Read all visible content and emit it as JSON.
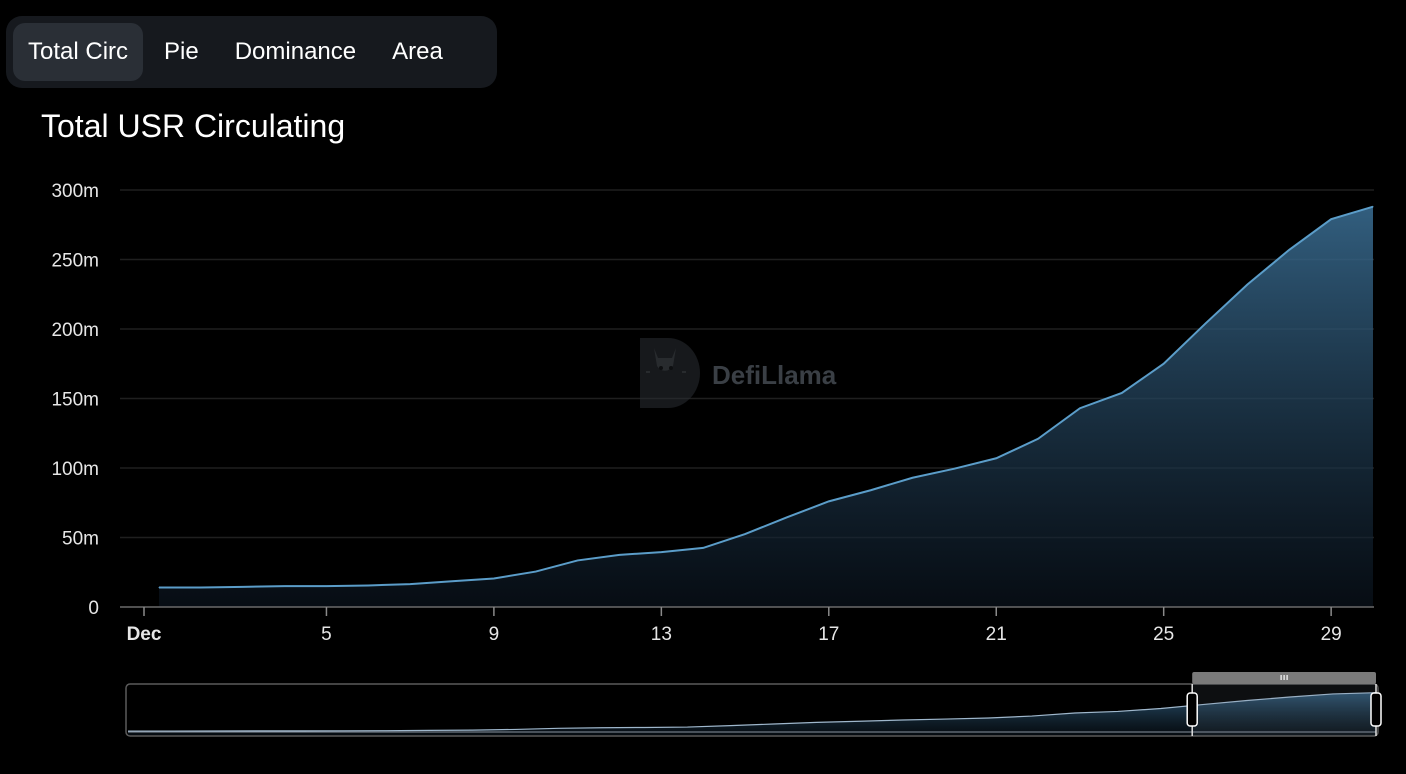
{
  "tabs": [
    {
      "label": "Total Circ",
      "active": true
    },
    {
      "label": "Pie",
      "active": false
    },
    {
      "label": "Dominance",
      "active": false
    },
    {
      "label": "Area",
      "active": false
    }
  ],
  "watermark": "DefiLlama",
  "colors": {
    "background": "#000000",
    "line": "#5b9dc9",
    "area_top": "#3b6f95",
    "grid": "#1f1f1f",
    "tab_bg": "#16191e",
    "tab_active_bg": "#2a2f36"
  },
  "chart_data": {
    "type": "area",
    "title": "Total USR Circulating",
    "x": [
      "Dec 1",
      "Dec 2",
      "Dec 3",
      "Dec 4",
      "Dec 5",
      "Dec 6",
      "Dec 7",
      "Dec 8",
      "Dec 9",
      "Dec 10",
      "Dec 11",
      "Dec 12",
      "Dec 13",
      "Dec 14",
      "Dec 15",
      "Dec 16",
      "Dec 17",
      "Dec 18",
      "Dec 19",
      "Dec 20",
      "Dec 21",
      "Dec 22",
      "Dec 23",
      "Dec 24",
      "Dec 25",
      "Dec 26",
      "Dec 27",
      "Dec 28",
      "Dec 29",
      "Dec 30"
    ],
    "x_ticks": [
      "Dec",
      "5",
      "9",
      "13",
      "17",
      "21",
      "25",
      "29"
    ],
    "y_ticks": [
      "0",
      "50m",
      "100m",
      "150m",
      "200m",
      "250m",
      "300m"
    ],
    "series": [
      {
        "values": [
          14,
          14,
          14.5,
          15,
          15,
          15.5,
          16.5,
          18.5,
          20.5,
          25.5,
          33.5,
          37.5,
          39.5,
          42.5,
          52.5,
          64.5,
          76,
          84,
          93,
          99.5,
          107,
          121,
          143,
          154,
          175,
          204,
          232,
          257,
          279,
          288
        ]
      }
    ],
    "ylim": [
      0,
      300
    ],
    "grid": true,
    "legend": "none",
    "brush": {
      "start_fraction": 0.85,
      "end_fraction": 1.0
    }
  }
}
